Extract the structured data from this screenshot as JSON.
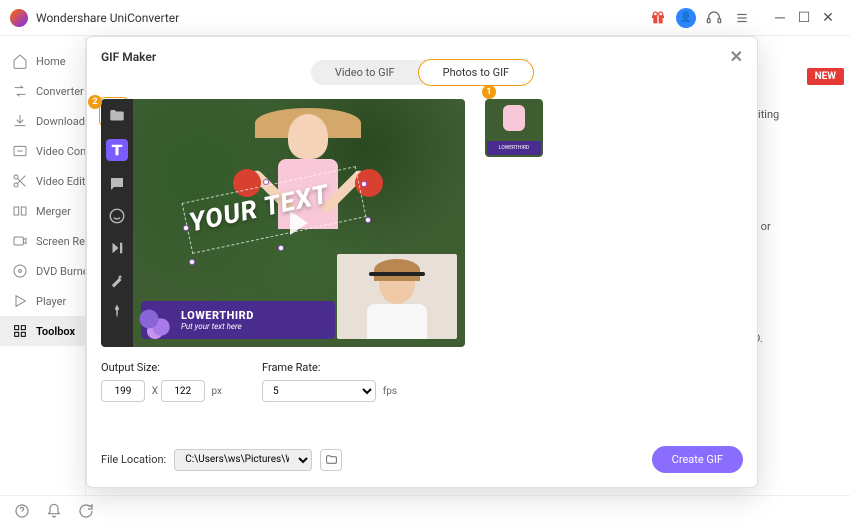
{
  "app": {
    "title": "Wondershare UniConverter"
  },
  "sidebar": {
    "items": [
      {
        "label": "Home"
      },
      {
        "label": "Converter"
      },
      {
        "label": "Downloader"
      },
      {
        "label": "Video Compressor"
      },
      {
        "label": "Video Editor"
      },
      {
        "label": "Merger"
      },
      {
        "label": "Screen Recorder"
      },
      {
        "label": "DVD Burner"
      },
      {
        "label": "Player"
      },
      {
        "label": "Toolbox"
      }
    ]
  },
  "badges": {
    "new": "NEW",
    "one": "1",
    "two": "2"
  },
  "bg_hints": {
    "editing": "editing",
    "ios_or": "os or",
    "cd": "CD."
  },
  "modal": {
    "title": "GIF Maker",
    "tabs": {
      "video": "Video to GIF",
      "photos": "Photos to GIF"
    },
    "overlay_text": "YOUR TEXT",
    "lower_third": {
      "title": "LOWERTHIRD",
      "sub": "Put your text here"
    },
    "params": {
      "output_label": "Output Size:",
      "width": "199",
      "sep": "X",
      "height": "122",
      "px": "px",
      "frame_label": "Frame Rate:",
      "fps_value": "5",
      "fps": "fps"
    },
    "footer": {
      "loc_label": "File Location:",
      "loc_value": "C:\\Users\\ws\\Pictures\\Wonders",
      "create": "Create GIF"
    }
  }
}
